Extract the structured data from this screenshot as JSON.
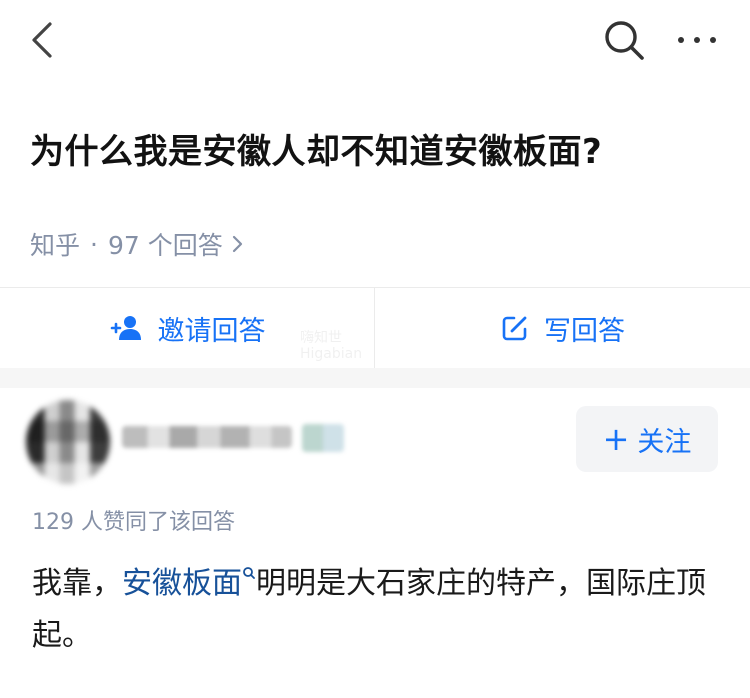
{
  "topbar": {
    "back_icon": "chevron-left-icon",
    "search_icon": "search-icon",
    "more_icon": "more-horizontal-icon"
  },
  "question": {
    "title": "为什么我是安徽人却不知道安徽板面?"
  },
  "meta": {
    "source": "知乎",
    "separator": "·",
    "answer_count": "97 个回答"
  },
  "actions": {
    "invite_label": "邀请回答",
    "write_label": "写回答",
    "invite_icon": "add-user-icon",
    "write_icon": "edit-icon"
  },
  "watermark": {
    "line1": "嗨知世",
    "line2": "Higabian"
  },
  "answer": {
    "author_name": "",
    "follow_label": "关注",
    "follow_plus": "+",
    "likes_text": "129 人赞同了该回答",
    "text_before": "我靠，",
    "keyword": "安徽板面",
    "text_after": "明明是大石家庄的特产，国际庄顶起。"
  },
  "colors": {
    "accent": "#1772f6",
    "keyword": "#175199",
    "meta_gray": "#8590a6",
    "title": "#121212"
  }
}
